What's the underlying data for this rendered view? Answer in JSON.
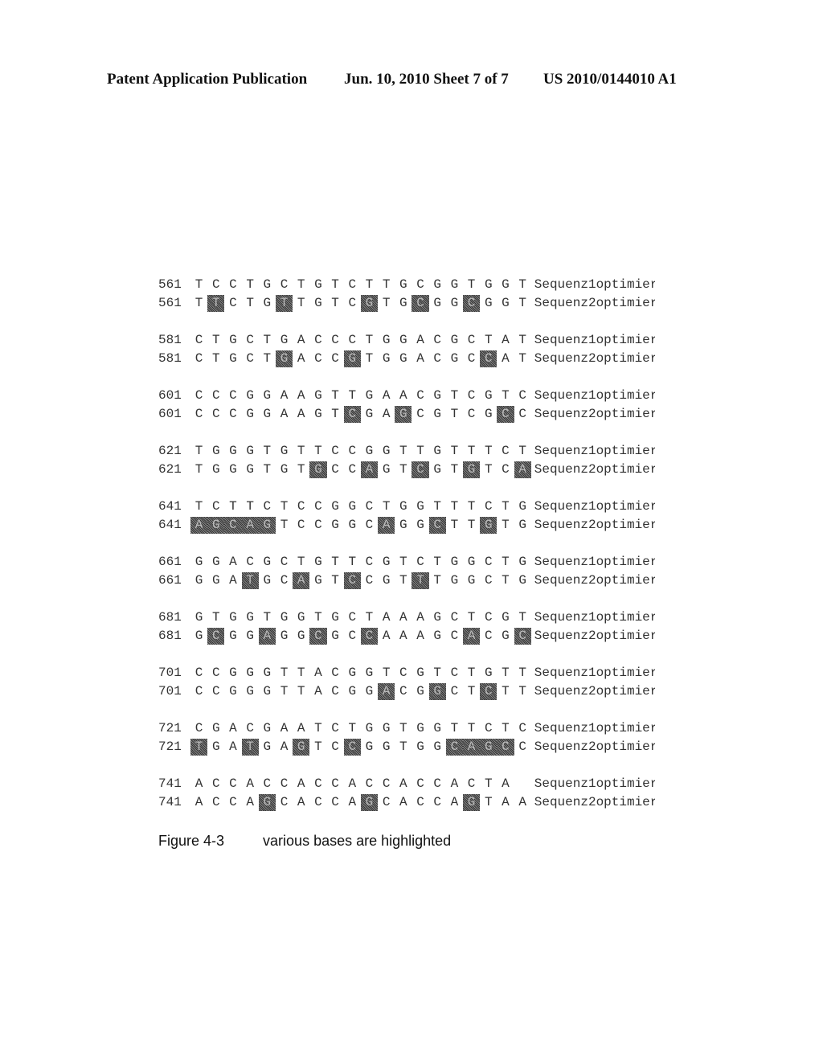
{
  "header": {
    "left": "Patent Application Publication",
    "center": "Jun. 10, 2010  Sheet 7 of 7",
    "right": "US 2010/0144010 A1"
  },
  "alignment": [
    {
      "start": "561",
      "seq1": "TCCTGCTGTCTTGCGGTGGT",
      "seq2": "TTCTGTTGTCGTGCGGCGGT",
      "hl2": [
        1,
        5,
        10,
        13,
        16
      ]
    },
    {
      "start": "581",
      "seq1": "CTGCTGACCCTGGACGCTAT",
      "seq2": "CTGCTGACCGTGGACGCCAT",
      "hl2": [
        5,
        9,
        17
      ]
    },
    {
      "start": "601",
      "seq1": "CCCGGAAGTTGAACGTCGTC",
      "seq2": "CCCGGAAGTCGAGCGTCGCC",
      "hl2": [
        9,
        12,
        18
      ]
    },
    {
      "start": "621",
      "seq1": "TGGGTGTTCCGGTTGTTTCT",
      "seq2": "TGGGTGTGCCAGTCGTGTCA",
      "hl2": [
        7,
        10,
        13,
        16,
        19
      ]
    },
    {
      "start": "641",
      "seq1": "TCTTCTCCGGCTGGTTTCTG",
      "seq2": "AGCAGTCCGGCAGGCTTGTG",
      "hl2": [
        0,
        1,
        2,
        3,
        4,
        11,
        14,
        17
      ]
    },
    {
      "start": "661",
      "seq1": "GGACGCTGTTCGTCTGGCTG",
      "seq2": "GGATGCAGTCCGTTTGGCTG",
      "hl2": [
        3,
        6,
        9,
        13
      ]
    },
    {
      "start": "681",
      "seq1": "GTGGTGGTGCTAAAGCTCGT",
      "seq2": "GCGGAGGCGCCAAAGCACGC",
      "hl2": [
        1,
        4,
        7,
        10,
        16,
        19
      ]
    },
    {
      "start": "701",
      "seq1": "CCGGGTTACGGTCGTCTGTT",
      "seq2": "CCGGGTTACGGACGGCTCTT",
      "hl2": [
        11,
        14,
        17
      ]
    },
    {
      "start": "721",
      "seq1": "CGACGAATCTGGTGGTTCTC",
      "seq2": "TGATGAGTCCGGTGGCAGCC",
      "hl2": [
        0,
        3,
        6,
        9,
        15,
        16,
        17,
        18
      ]
    },
    {
      "start": "741",
      "seq1": "ACCACCACCACCACCACTA",
      "seq2": "ACCAGCACCAGCACCAGTAA",
      "hl2": [
        4,
        10,
        16
      ]
    }
  ],
  "labels": {
    "seq1": "Sequenz1optimiert",
    "seq2": "Sequenz2optimiert"
  },
  "caption": {
    "figure": "Figure 4-3",
    "text": "various bases are highlighted"
  }
}
